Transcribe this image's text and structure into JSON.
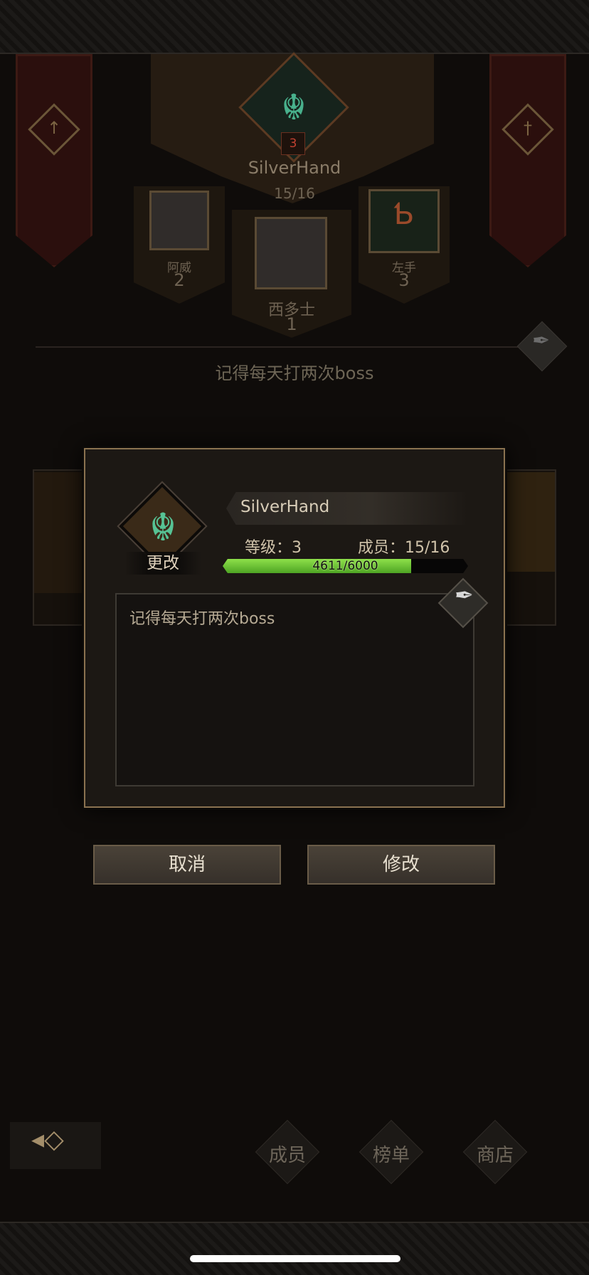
{
  "background": {
    "guild": {
      "name": "SilverHand",
      "members": "15/16",
      "level": "3",
      "notice": "记得每天打两次boss"
    },
    "ranking": [
      {
        "name": "阿威",
        "rank": "2"
      },
      {
        "name": "西多士",
        "rank": "1"
      },
      {
        "name": "左手",
        "rank": "3"
      }
    ],
    "nav": {
      "tabs": [
        {
          "label": "成员"
        },
        {
          "label": "榜单"
        },
        {
          "label": "商店"
        }
      ]
    }
  },
  "dialog": {
    "change_label": "更改",
    "guild_name": "SilverHand",
    "level_label": "等级：3",
    "members_label": "成员：15/16",
    "xp": {
      "text": "4611/6000",
      "current": 4611,
      "max": 6000
    },
    "notice_text": "记得每天打两次boss",
    "cancel_label": "取消",
    "edit_label": "修改"
  },
  "icons": {
    "guild_emblem": "snake-emblem-icon",
    "quill": "quill-icon",
    "back": "back-arrow-icon"
  },
  "colors": {
    "xp_fill": "#6cc234",
    "frame_gold": "#8a7250",
    "banner_red": "#2b0f0d"
  }
}
